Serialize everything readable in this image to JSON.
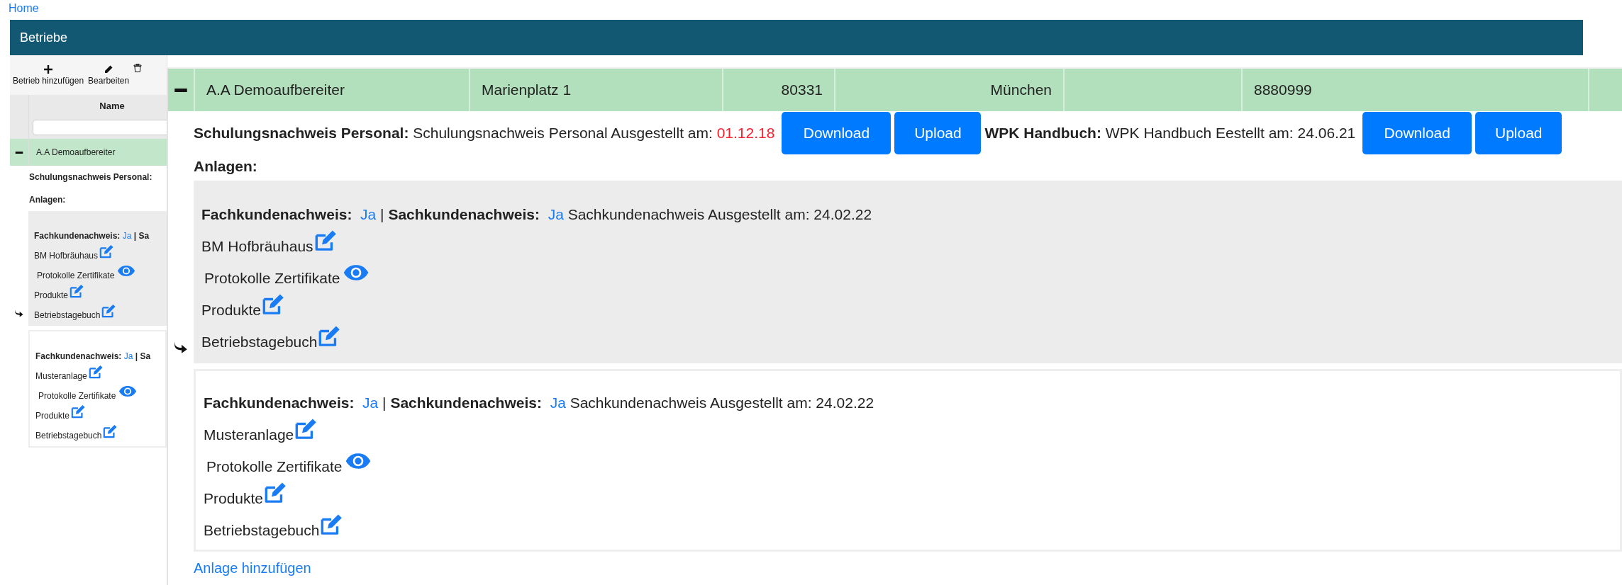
{
  "breadcrumb": {
    "label": "Home"
  },
  "panel_title": "Betriebe",
  "toolbar": [
    {
      "label": "Betrieb hinzufügen"
    },
    {
      "label": "Bearbeiten"
    }
  ],
  "background_table": {
    "column_header": "Name",
    "row": {
      "expanded": true,
      "name": "A.A Demoaufbereiter"
    },
    "details_label": "Schulungsnachweis Personal:",
    "anlagen_label": "Anlagen:",
    "anlagen": [
      {
        "highlighted": true,
        "fach_label": "Fachkundenachweis:",
        "fach_value": "Ja",
        "separator": "|",
        "sach_label": "Sa",
        "name": "BM Hofbräuhaus",
        "items": [
          {
            "label": "Protokolle Zertifikate",
            "kind": "view"
          },
          {
            "label": "Produkte",
            "kind": "edit"
          },
          {
            "label": "Betriebstagebuch",
            "kind": "edit"
          }
        ]
      },
      {
        "highlighted": false,
        "fach_label": "Fachkundenachweis:",
        "fach_value": "Ja",
        "separator": "|",
        "sach_label": "Sa",
        "name": "Musteranlage",
        "items": [
          {
            "label": "Protokolle Zertifikate",
            "kind": "view"
          },
          {
            "label": "Produkte",
            "kind": "edit"
          },
          {
            "label": "Betriebstagebuch",
            "kind": "edit"
          }
        ]
      }
    ]
  },
  "zoomed_detail": {
    "row": {
      "expanded": true,
      "cells": [
        {
          "kind": "text",
          "text": "A.A Demoaufbereiter"
        },
        {
          "kind": "text",
          "text": "Marienplatz 1"
        },
        {
          "kind": "numeric",
          "text": "80331"
        },
        {
          "kind": "numeric",
          "text": "München"
        },
        {
          "kind": "empty"
        },
        {
          "kind": "text",
          "text": "8880999"
        },
        {
          "kind": "empty"
        }
      ]
    },
    "documents": [
      {
        "label": "Schulungsnachweis Personal:",
        "text": "Schulungsnachweis Personal Ausgestellt am:",
        "date": "01.12.18",
        "expired": true,
        "buttons": [
          "Download",
          "Upload"
        ]
      },
      {
        "label": "WPK Handbuch:",
        "text": "WPK Handbuch Eestellt am:",
        "date": "24.06.21",
        "expired": false,
        "buttons": [
          "Download",
          "Upload"
        ]
      }
    ],
    "anlagen_label": "Anlagen:",
    "anlagen": [
      {
        "highlighted": true,
        "fach_label": "Fachkundenachweis:",
        "fach_value": "Ja",
        "separator": "|",
        "sach_label": "Sachkundenachweis:",
        "sach_value": "Ja",
        "sach_text": "Sachkundenachweis Ausgestellt am: 24.02.22",
        "name": "BM Hofbräuhaus",
        "items": [
          {
            "label": "Protokolle Zertifikate",
            "kind": "view"
          },
          {
            "label": "Produkte",
            "kind": "edit"
          },
          {
            "label": "Betriebstagebuch",
            "kind": "edit"
          }
        ]
      },
      {
        "highlighted": false,
        "fach_label": "Fachkundenachweis:",
        "fach_value": "Ja",
        "separator": "|",
        "sach_label": "Sachkundenachweis:",
        "sach_value": "Ja",
        "sach_text": "Sachkundenachweis Ausgestellt am: 24.02.22",
        "name": "Musteranlage",
        "items": [
          {
            "label": "Protokolle Zertifikate",
            "kind": "view"
          },
          {
            "label": "Produkte",
            "kind": "edit"
          },
          {
            "label": "Betriebstagebuch",
            "kind": "edit"
          }
        ]
      }
    ],
    "add_link": "Anlage hinzufügen"
  }
}
